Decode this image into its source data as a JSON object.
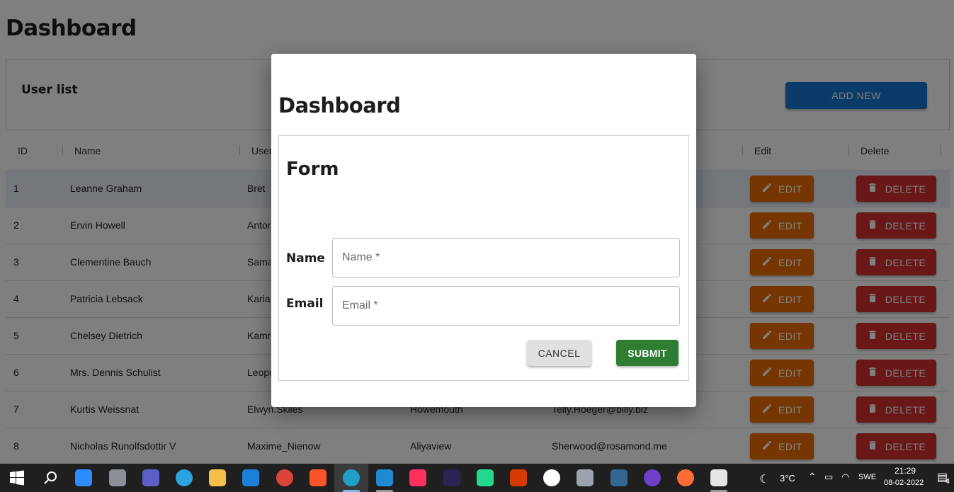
{
  "page": {
    "title": "Dashboard"
  },
  "userlist": {
    "title": "User list",
    "add_new_label": "ADD NEW"
  },
  "table": {
    "columns": [
      "ID",
      "Name",
      "User",
      "Edit",
      "Delete"
    ],
    "rows": [
      {
        "id": "1",
        "name": "Leanne Graham",
        "username": "Bret",
        "city": "",
        "email": ""
      },
      {
        "id": "2",
        "name": "Ervin Howell",
        "username": "Anton",
        "city": "",
        "email": ""
      },
      {
        "id": "3",
        "name": "Clementine Bauch",
        "username": "Sama",
        "city": "",
        "email": ""
      },
      {
        "id": "4",
        "name": "Patricia Lebsack",
        "username": "Karia",
        "city": "",
        "email": ""
      },
      {
        "id": "5",
        "name": "Chelsey Dietrich",
        "username": "Kamr",
        "city": "",
        "email": ""
      },
      {
        "id": "6",
        "name": "Mrs. Dennis Schulist",
        "username": "Leopo",
        "city": "",
        "email": ""
      },
      {
        "id": "7",
        "name": "Kurtis Weissnat",
        "username": "Elwyn.Skiles",
        "city": "Howemouth",
        "email": "Telly.Hoeger@billy.biz"
      },
      {
        "id": "8",
        "name": "Nicholas Runolfsdottir V",
        "username": "Maxime_Nienow",
        "city": "Aliyaview",
        "email": "Sherwood@rosamond.me"
      }
    ],
    "edit_label": "EDIT",
    "delete_label": "DELETE"
  },
  "modal": {
    "title": "Dashboard",
    "form_title": "Form",
    "name_label": "Name",
    "name_placeholder": "Name *",
    "email_label": "Email",
    "email_placeholder": "Email *",
    "cancel_label": "CANCEL",
    "submit_label": "SUBMIT"
  },
  "taskbar": {
    "apps": [
      "windows-start",
      "search",
      "zoom",
      "camera",
      "teams",
      "telegram",
      "file-explorer",
      "mail",
      "chrome",
      "brave",
      "edge",
      "vscode",
      "intellij",
      "eclipse",
      "datagrip",
      "office",
      "mongodb",
      "database",
      "postgresql",
      "github",
      "postman",
      "paint"
    ],
    "weather": "3°C",
    "language": "SWE",
    "time": "21:29",
    "date": "08-02-2022",
    "notification_count": "4"
  },
  "colors": {
    "primary": "#1976d2",
    "edit": "#ed6c02",
    "delete": "#d32f2f",
    "submit": "#2e7d32",
    "selected_row": "#e9f0fa"
  }
}
